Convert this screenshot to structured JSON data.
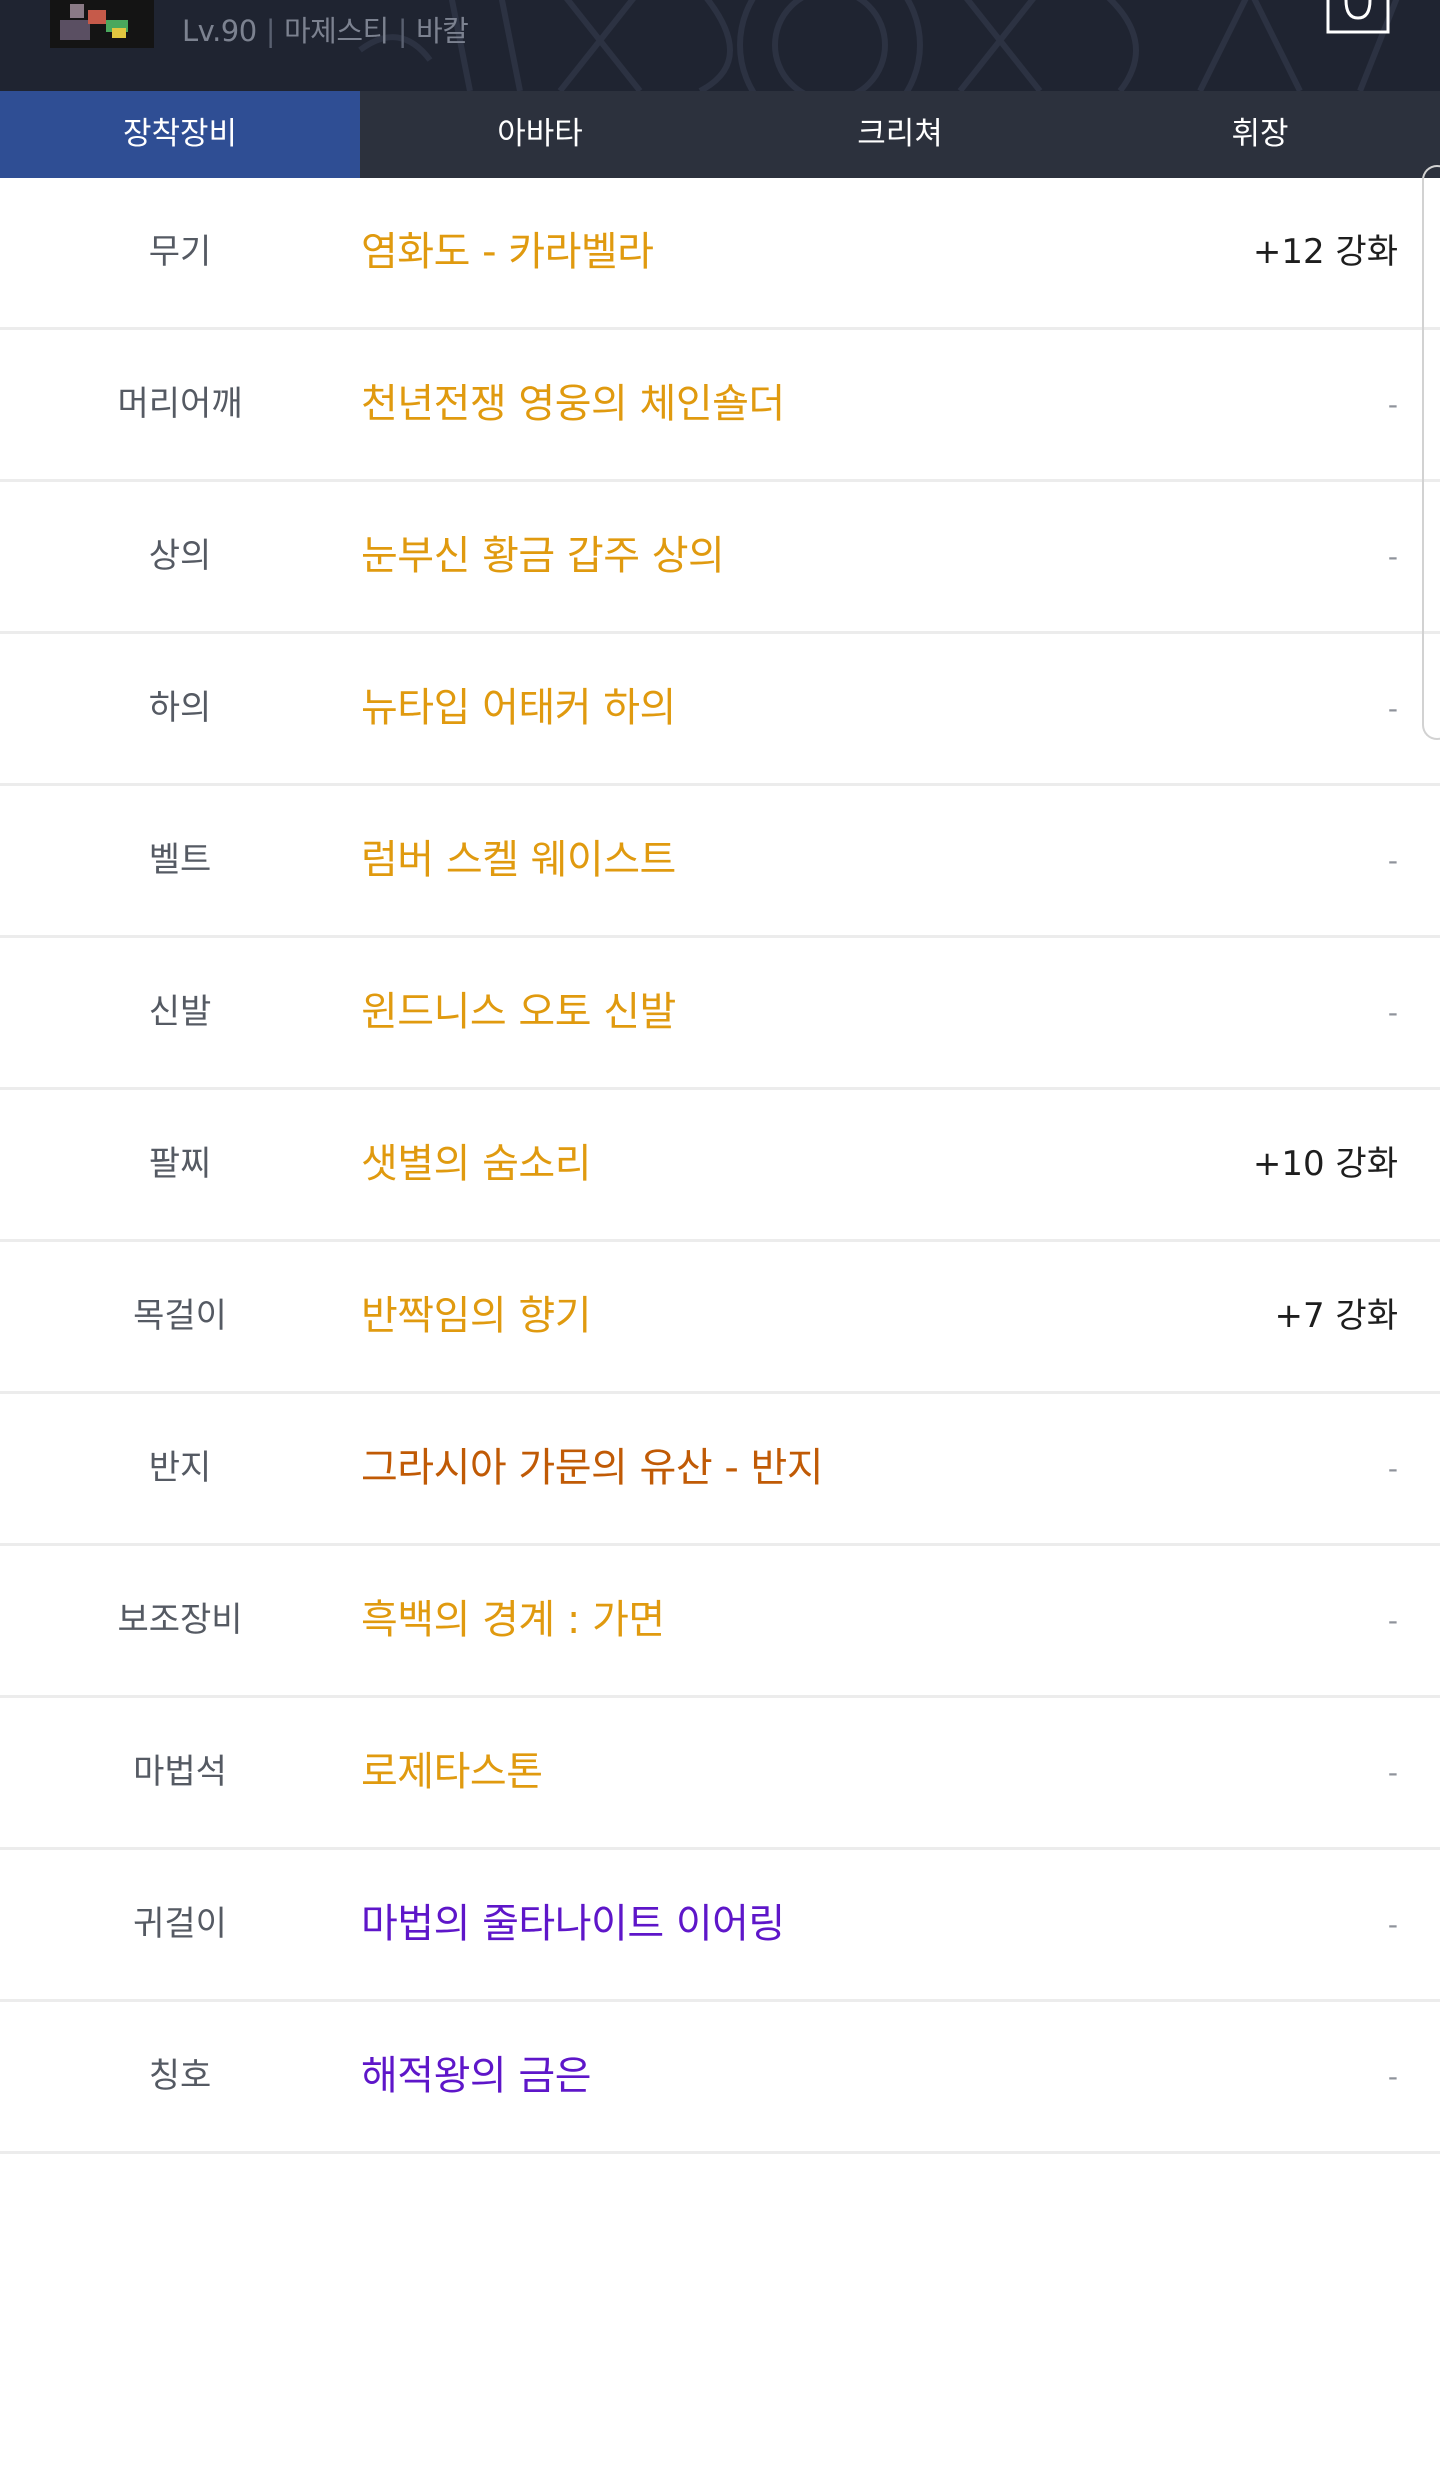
{
  "header": {
    "level": "Lv.90",
    "job": "마제스티",
    "server": "바칼",
    "separator": "|",
    "bag_icon": "bag-icon"
  },
  "tabs": [
    {
      "label": "장착장비",
      "active": true
    },
    {
      "label": "아바타",
      "active": false
    },
    {
      "label": "크리쳐",
      "active": false
    },
    {
      "label": "휘장",
      "active": false
    }
  ],
  "colors": {
    "tab_active": "#2f4e94",
    "header_bg": "#1f2431",
    "tab_bar_bg": "#2c313d",
    "epic": "#e09a0f",
    "legendary": "#c05a05",
    "unique": "#5e16c9"
  },
  "equipment": [
    {
      "slot": "무기",
      "name": "염화도 - 카라벨라",
      "enhance": "+12 강화",
      "color": "#e09a0f"
    },
    {
      "slot": "머리어깨",
      "name": "천년전쟁 영웅의 체인숄더",
      "enhance": "-",
      "color": "#e09a0f"
    },
    {
      "slot": "상의",
      "name": "눈부신 황금 갑주 상의",
      "enhance": "-",
      "color": "#e09a0f"
    },
    {
      "slot": "하의",
      "name": "뉴타입 어태커 하의",
      "enhance": "-",
      "color": "#e09a0f"
    },
    {
      "slot": "벨트",
      "name": "럼버 스켈 웨이스트",
      "enhance": "-",
      "color": "#e09a0f"
    },
    {
      "slot": "신발",
      "name": "윈드니스 오토 신발",
      "enhance": "-",
      "color": "#e09a0f"
    },
    {
      "slot": "팔찌",
      "name": "샛별의 숨소리",
      "enhance": "+10 강화",
      "color": "#e09a0f"
    },
    {
      "slot": "목걸이",
      "name": "반짝임의 향기",
      "enhance": "+7 강화",
      "color": "#e09a0f"
    },
    {
      "slot": "반지",
      "name": "그라시아 가문의 유산 - 반지",
      "enhance": "-",
      "color": "#c05a05"
    },
    {
      "slot": "보조장비",
      "name": "흑백의 경계 : 가면",
      "enhance": "-",
      "color": "#e09a0f"
    },
    {
      "slot": "마법석",
      "name": "로제타스톤",
      "enhance": "-",
      "color": "#e09a0f"
    },
    {
      "slot": "귀걸이",
      "name": "마법의 줄타나이트 이어링",
      "enhance": "-",
      "color": "#5e16c9"
    },
    {
      "slot": "칭호",
      "name": "해적왕의 금은",
      "enhance": "-",
      "color": "#5e16c9"
    }
  ]
}
